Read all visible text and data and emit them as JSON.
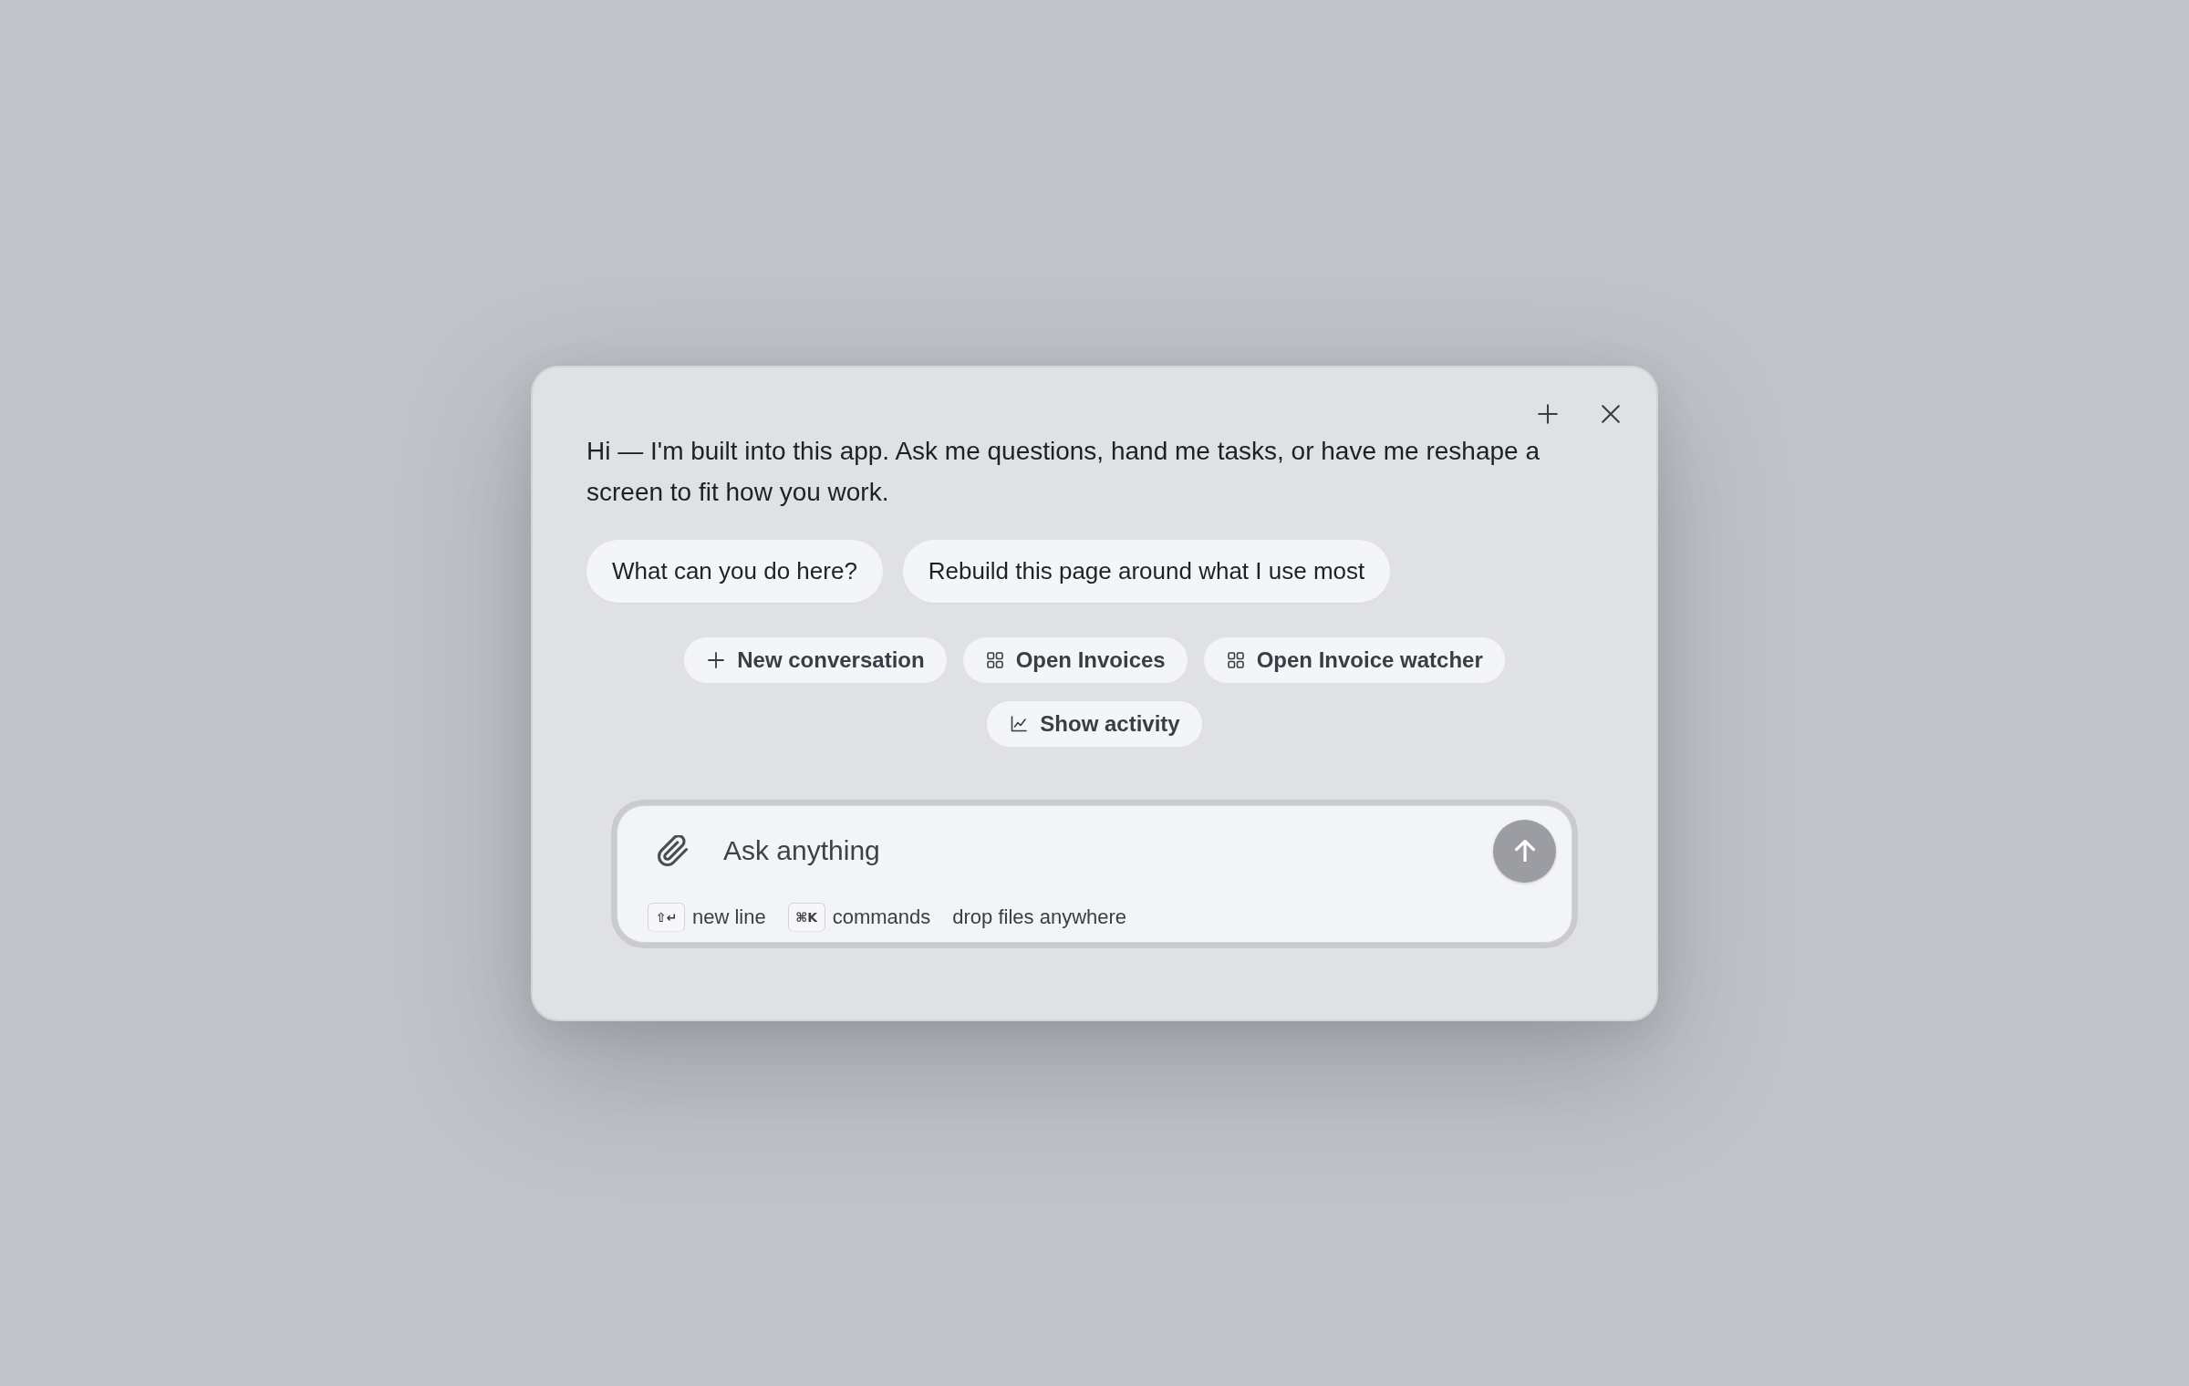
{
  "intro": {
    "text": "Hi — I'm built into this app. Ask me questions, hand me tasks, or have me reshape a screen to fit how you work."
  },
  "suggestions": [
    "What can you do here?",
    "Rebuild this page around what I use most"
  ],
  "actions": [
    {
      "kind": "add",
      "label": "New conversation"
    },
    {
      "kind": "grid",
      "label": "Open Invoices"
    },
    {
      "kind": "grid",
      "label": "Open Invoice watcher"
    },
    {
      "kind": "chart",
      "label": "Show activity"
    }
  ],
  "composer": {
    "placeholder": "Ask anything",
    "send_button": {
      "disabled": true
    },
    "hints": [
      {
        "keys": "⇧↵",
        "label": "new line"
      },
      {
        "keys": "⌘K",
        "label": "commands"
      },
      {
        "label": "drop files anywhere"
      }
    ]
  }
}
